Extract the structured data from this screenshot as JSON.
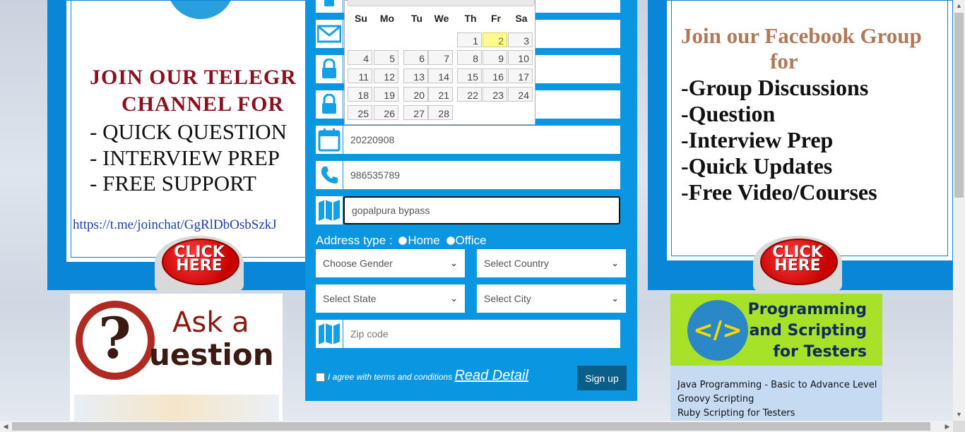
{
  "telegram": {
    "heading1": "JOIN OUR TELEGR",
    "heading2": "CHANNEL  FOR",
    "items": [
      "- QUICK QUESTION",
      "- INTERVIEW PREP",
      "- FREE SUPPORT"
    ],
    "link": "https://t.me/joinchat/GgRlDbOsbSzkJ",
    "click": "CLICK HERE"
  },
  "ask": {
    "line1": "Ask a",
    "line2": "uestion"
  },
  "form": {
    "date_value": "20220908",
    "phone_value": "986535789",
    "address_value": "gopalpura bypass",
    "address_type_label": "Address type :",
    "radio_home": "Home",
    "radio_office": "Office",
    "gender": "Choose Gender",
    "country": "Select Country",
    "state": "Select State",
    "city": "Select City",
    "zip_placeholder": "Zip code",
    "agree_text": "I agree with terms and conditions",
    "read_detail": "Read Detail",
    "signup": "Sign up"
  },
  "calendar": {
    "weekdays": [
      "Su",
      "Mo",
      "Tu",
      "We",
      "Th",
      "Fr",
      "Sa"
    ],
    "first_weekday_index": 3,
    "days_in_month": 28,
    "today": 2
  },
  "facebook": {
    "heading1": "Join our Facebook Group",
    "heading2": "for",
    "items": [
      "-Group Discussions",
      "-Question",
      "-Interview Prep",
      "-Quick Updates",
      "-Free Video/Courses"
    ],
    "click": "CLICK HERE"
  },
  "programming": {
    "symbol": "</>",
    "title": "Programming\nand Scripting\nfor Testers",
    "list": [
      "Java Programming - Basic to Advance Level",
      "Groovy Scripting",
      "Ruby Scripting for Testers"
    ]
  }
}
